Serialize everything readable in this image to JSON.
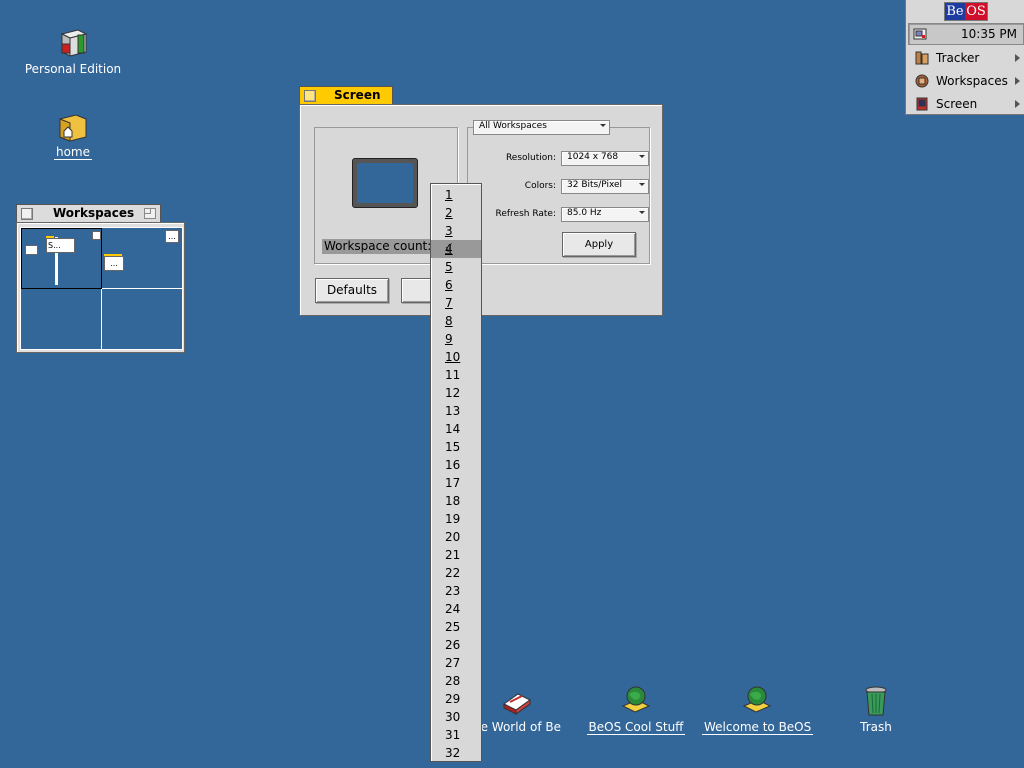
{
  "desktop": {
    "icons": [
      {
        "label": "Personal Edition"
      },
      {
        "label": "home"
      },
      {
        "label": "he World of Be"
      },
      {
        "label": "BeOS Cool Stuff"
      },
      {
        "label": "Welcome to BeOS"
      },
      {
        "label": "Trash"
      }
    ]
  },
  "deskbar": {
    "logo_be": "Be",
    "logo_os": "OS",
    "clock": "10:35 PM",
    "items": [
      {
        "label": "Tracker"
      },
      {
        "label": "Workspaces"
      },
      {
        "label": "Screen"
      }
    ]
  },
  "workspaces_window": {
    "title": "Workspaces",
    "mini_labels": [
      "S...",
      "...",
      "..."
    ]
  },
  "screen_window": {
    "title": "Screen",
    "workspace_scope": "All Workspaces",
    "resolution_label": "Resolution:",
    "resolution_value": "1024 x 768",
    "colors_label": "Colors:",
    "colors_value": "32 Bits/Pixel",
    "refresh_label": "Refresh Rate:",
    "refresh_value": "85.0 Hz",
    "apply_label": "Apply",
    "workspace_count_label": "Workspace count:",
    "defaults_label": "Defaults",
    "revert_label": "Re"
  },
  "workspace_popup": {
    "selected": "4",
    "check": "√",
    "items": [
      "1",
      "2",
      "3",
      "4",
      "5",
      "6",
      "7",
      "8",
      "9",
      "10",
      "11",
      "12",
      "13",
      "14",
      "15",
      "16",
      "17",
      "18",
      "19",
      "20",
      "21",
      "22",
      "23",
      "24",
      "25",
      "26",
      "27",
      "28",
      "29",
      "30",
      "31",
      "32"
    ]
  },
  "colors": {
    "desktop": "#336699",
    "active_tab": "#ffcb00",
    "logo_blue": "#1e3ca0",
    "logo_red": "#d0102a"
  }
}
